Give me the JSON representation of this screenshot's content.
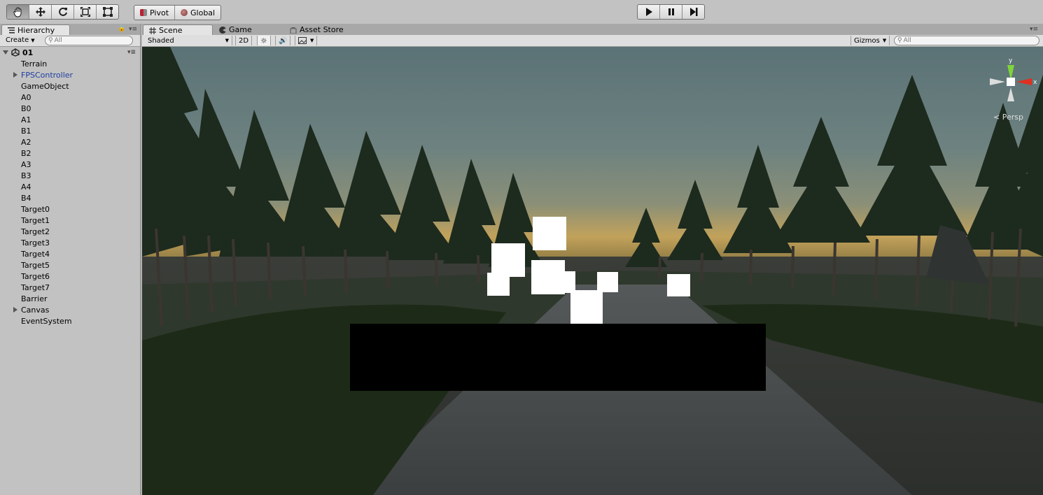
{
  "toolbar": {
    "tools": [
      "hand-tool",
      "move-tool",
      "rotate-tool",
      "scale-tool",
      "rect-tool"
    ],
    "pivot_label": "Pivot",
    "global_label": "Global",
    "play_controls": [
      "play",
      "pause",
      "step"
    ]
  },
  "hierarchy": {
    "tab_label": "Hierarchy",
    "create_label": "Create",
    "search_placeholder": "All",
    "scene_name": "01",
    "items": [
      {
        "label": "Terrain",
        "expandable": false,
        "prefab": false
      },
      {
        "label": "FPSController",
        "expandable": true,
        "prefab": true
      },
      {
        "label": "GameObject",
        "expandable": false,
        "prefab": false
      },
      {
        "label": "A0",
        "expandable": false,
        "prefab": false
      },
      {
        "label": "B0",
        "expandable": false,
        "prefab": false
      },
      {
        "label": "A1",
        "expandable": false,
        "prefab": false
      },
      {
        "label": "B1",
        "expandable": false,
        "prefab": false
      },
      {
        "label": "A2",
        "expandable": false,
        "prefab": false
      },
      {
        "label": "B2",
        "expandable": false,
        "prefab": false
      },
      {
        "label": "A3",
        "expandable": false,
        "prefab": false
      },
      {
        "label": "B3",
        "expandable": false,
        "prefab": false
      },
      {
        "label": "A4",
        "expandable": false,
        "prefab": false
      },
      {
        "label": "B4",
        "expandable": false,
        "prefab": false
      },
      {
        "label": "Target0",
        "expandable": false,
        "prefab": false
      },
      {
        "label": "Target1",
        "expandable": false,
        "prefab": false
      },
      {
        "label": "Target2",
        "expandable": false,
        "prefab": false
      },
      {
        "label": "Target3",
        "expandable": false,
        "prefab": false
      },
      {
        "label": "Target4",
        "expandable": false,
        "prefab": false
      },
      {
        "label": "Target5",
        "expandable": false,
        "prefab": false
      },
      {
        "label": "Target6",
        "expandable": false,
        "prefab": false
      },
      {
        "label": "Target7",
        "expandable": false,
        "prefab": false
      },
      {
        "label": "Barrier",
        "expandable": false,
        "prefab": false
      },
      {
        "label": "Canvas",
        "expandable": true,
        "prefab": false
      },
      {
        "label": "EventSystem",
        "expandable": false,
        "prefab": false
      }
    ]
  },
  "scene": {
    "tabs": [
      {
        "label": "Scene",
        "active": true
      },
      {
        "label": "Game",
        "active": false
      },
      {
        "label": "Asset Store",
        "active": false
      }
    ],
    "shading_mode": "Shaded",
    "mode_2d_label": "2D",
    "gizmos_label": "Gizmos",
    "search_placeholder": "All",
    "projection_label": "Persp",
    "gizmo_axes": {
      "y": "y",
      "x": "x"
    }
  },
  "colors": {
    "panel_bg": "#c2c2c2",
    "prefab_text": "#1d3ea0",
    "axis_y": "#7fd43a",
    "axis_x": "#e0301e"
  }
}
